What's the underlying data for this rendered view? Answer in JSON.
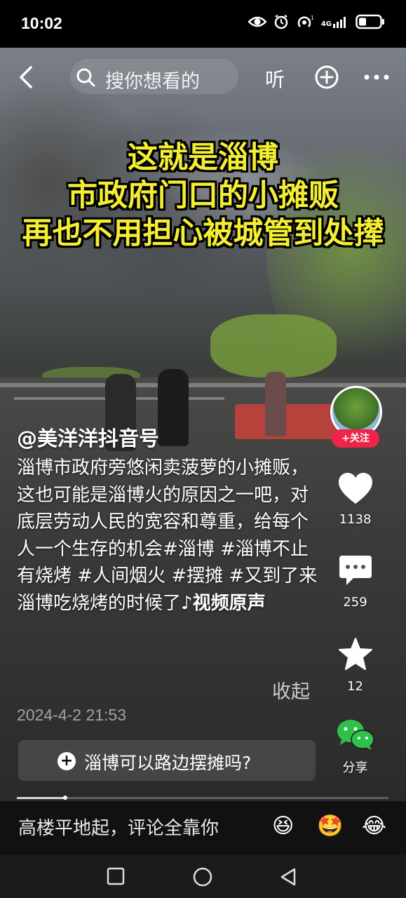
{
  "status_bar": {
    "time": "10:02",
    "network": "4G",
    "icons": [
      "eye-icon",
      "alarm-icon",
      "hotspot-icon",
      "signal-icon",
      "battery-icon"
    ]
  },
  "top_nav": {
    "search_placeholder": "搜你想看的",
    "listen_label": "听",
    "icons": [
      "back-icon",
      "search-icon",
      "add-icon",
      "more-icon"
    ]
  },
  "video": {
    "caption_lines": [
      "这就是淄博",
      "市政府门口的小摊贩",
      "再也不用担心被城管到处撵"
    ]
  },
  "author": {
    "handle": "@美洋洋抖音号",
    "follow_label": "+关注"
  },
  "description": {
    "text": "淄博市政府旁悠闲卖菠萝的小摊贩，这也可能是淄博火的原因之一吧，对底层劳动人民的宽容和尊重，给每个人一个生存的机会",
    "hashtags": [
      "#淄博",
      "#淄博不止有烧烤",
      "#人间烟火",
      "#摆摊",
      "#又到了来淄博吃烧烤的时候了"
    ],
    "music": "♪视频原声",
    "collapse_label": "收起",
    "date": "2024-4-2 21:53"
  },
  "related_search": {
    "label": "淄博可以路边摆摊吗?"
  },
  "actions": {
    "likes": "1138",
    "comments": "259",
    "favorites": "12",
    "share_label": "分享"
  },
  "progress": {
    "fraction": 0.13
  },
  "comment_bar": {
    "placeholder": "高楼平地起，评论全靠你",
    "emojis": [
      "😆",
      "🤩",
      "😂"
    ]
  },
  "colors": {
    "caption": "#f4ee33",
    "follow": "#f0234a",
    "wechat": "#2ec24a"
  }
}
